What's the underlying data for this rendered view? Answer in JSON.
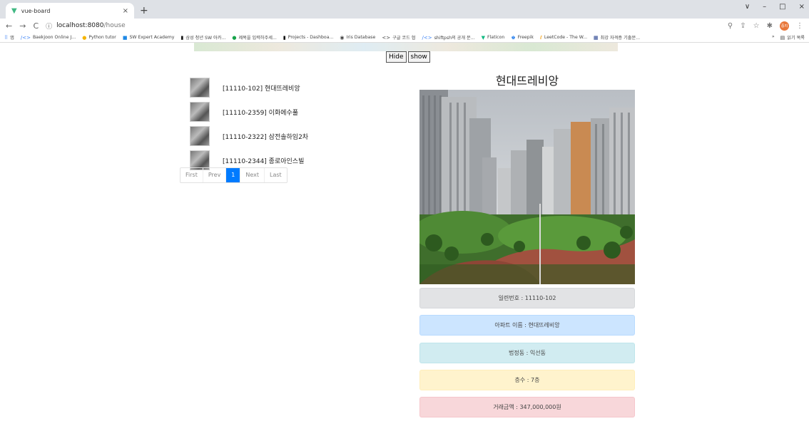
{
  "browser": {
    "tab_title": "vue-board",
    "tab_close": "×",
    "new_tab": "+",
    "url_host": "localhost:8080",
    "url_path": "/house",
    "window_controls": [
      "∨",
      "–",
      "□",
      "×"
    ],
    "profile_label": "중지",
    "bookmarks": [
      {
        "icon": "apps-icon",
        "label": "앱"
      },
      {
        "icon": "code-icon",
        "label": "Baekjoon Online J..."
      },
      {
        "icon": "python-icon",
        "label": "Python tutor"
      },
      {
        "icon": "swea-icon",
        "label": "SW Expert Academy"
      },
      {
        "icon": "notion-icon",
        "label": "삼성 청년 SW 아카..."
      },
      {
        "icon": "green-icon",
        "label": "제목을 입력하주세..."
      },
      {
        "icon": "notion-icon",
        "label": "Projects - Dashboa..."
      },
      {
        "icon": "iris-icon",
        "label": "Iris Database"
      },
      {
        "icon": "code-icon",
        "label": "구글 코드 협"
      },
      {
        "icon": "code-icon",
        "label": "shiftpsh의 공개 문..."
      },
      {
        "icon": "flaticon-icon",
        "label": "Flaticon"
      },
      {
        "icon": "freepik-icon",
        "label": "Freepik"
      },
      {
        "icon": "leetcode-icon",
        "label": "LeetCode - The W..."
      },
      {
        "icon": "bookmark-icon",
        "label": "최강 자격증 기출문..."
      }
    ],
    "bookmarks_more": "»",
    "reading_list": "읽기 목록"
  },
  "toggle": {
    "hide_label": "Hide",
    "show_label": "show"
  },
  "house_list": [
    {
      "label": "[11110-102] 현대뜨레비앙"
    },
    {
      "label": "[11110-2359] 이화에수풀"
    },
    {
      "label": "[11110-2322] 삼전솔하임2차"
    },
    {
      "label": "[11110-2344] 종로아인스빌"
    }
  ],
  "pagination": {
    "first": "First",
    "prev": "Prev",
    "current": "1",
    "next": "Next",
    "last": "Last"
  },
  "detail": {
    "title": "현대뜨레비앙",
    "serial": "일련번호 : 11110-102",
    "apt_name": "아파트 이름 : 현대뜨레비앙",
    "dong": "법정동 : 익선동",
    "floor": "층수 : 7층",
    "price": "거래금액 : 347,000,000원"
  },
  "colors": {
    "active_page": "#007bff"
  }
}
